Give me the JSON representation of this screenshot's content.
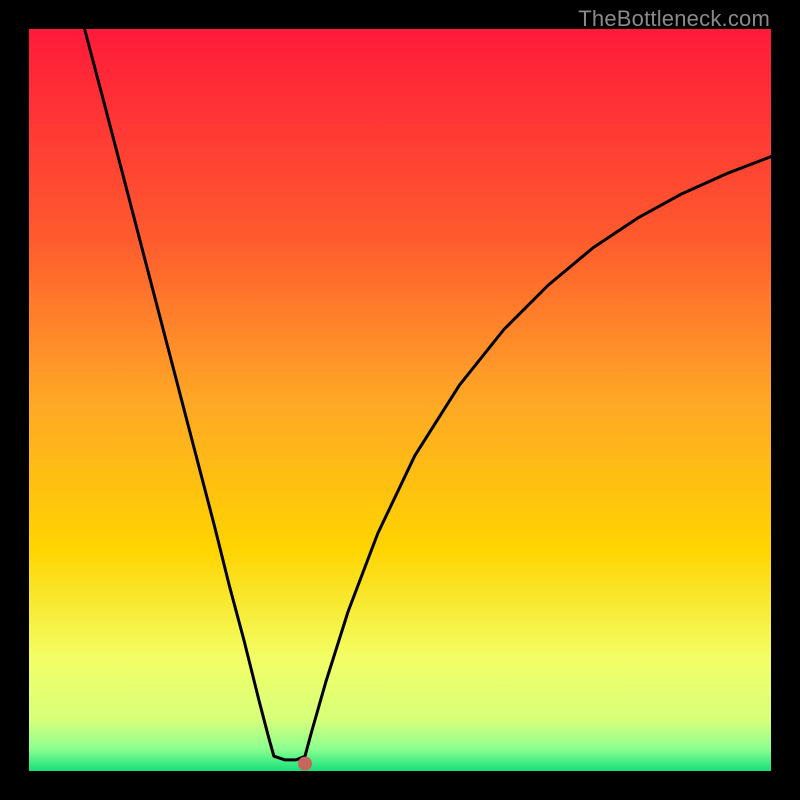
{
  "watermark": "TheBottleneck.com",
  "chart_data": {
    "type": "line",
    "title": "",
    "xlabel": "",
    "ylabel": "",
    "xlim": [
      0,
      1
    ],
    "ylim": [
      0,
      1
    ],
    "background_gradient": {
      "top": "#ff1a3a",
      "mid_upper": "#ff8a2a",
      "mid": "#ffd400",
      "mid_lower": "#f5ff6a",
      "near_bottom": "#c8ff80",
      "bottom": "#16e07a"
    },
    "series": [
      {
        "name": "curve",
        "color": "#000000",
        "points": [
          {
            "x": 0.075,
            "y": 1.0
          },
          {
            "x": 0.1,
            "y": 0.905
          },
          {
            "x": 0.13,
            "y": 0.79
          },
          {
            "x": 0.16,
            "y": 0.675
          },
          {
            "x": 0.19,
            "y": 0.56
          },
          {
            "x": 0.22,
            "y": 0.445
          },
          {
            "x": 0.25,
            "y": 0.33
          },
          {
            "x": 0.27,
            "y": 0.25
          },
          {
            "x": 0.29,
            "y": 0.175
          },
          {
            "x": 0.31,
            "y": 0.095
          },
          {
            "x": 0.323,
            "y": 0.045
          },
          {
            "x": 0.33,
            "y": 0.02
          },
          {
            "x": 0.345,
            "y": 0.015
          },
          {
            "x": 0.36,
            "y": 0.015
          },
          {
            "x": 0.372,
            "y": 0.02
          },
          {
            "x": 0.38,
            "y": 0.05
          },
          {
            "x": 0.4,
            "y": 0.12
          },
          {
            "x": 0.43,
            "y": 0.215
          },
          {
            "x": 0.47,
            "y": 0.32
          },
          {
            "x": 0.52,
            "y": 0.425
          },
          {
            "x": 0.58,
            "y": 0.52
          },
          {
            "x": 0.64,
            "y": 0.595
          },
          {
            "x": 0.7,
            "y": 0.655
          },
          {
            "x": 0.76,
            "y": 0.705
          },
          {
            "x": 0.82,
            "y": 0.745
          },
          {
            "x": 0.88,
            "y": 0.778
          },
          {
            "x": 0.94,
            "y": 0.805
          },
          {
            "x": 1.0,
            "y": 0.828
          }
        ]
      }
    ],
    "marker": {
      "x": 0.372,
      "y": 0.01,
      "color": "#c4675d",
      "radius_px": 7
    }
  }
}
